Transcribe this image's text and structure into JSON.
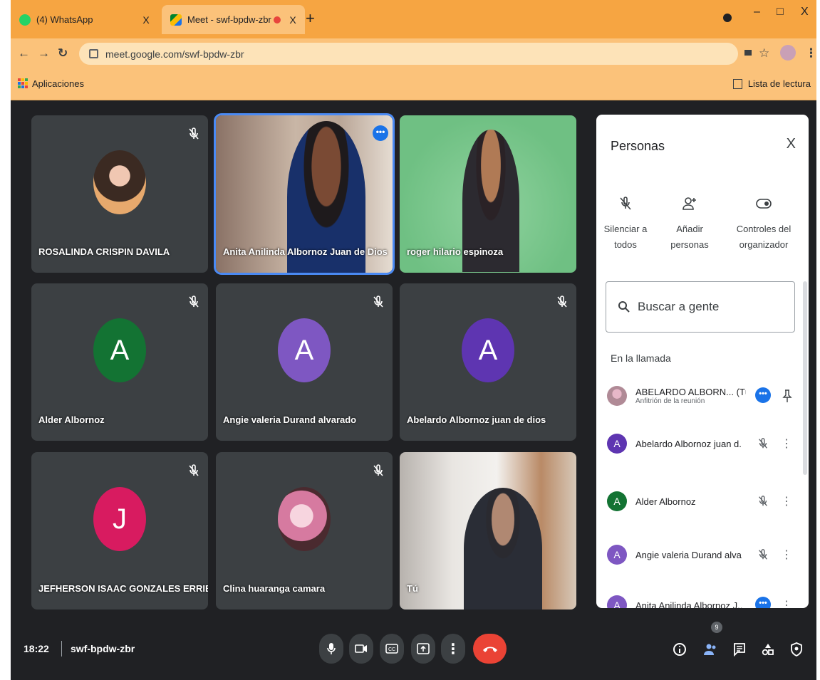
{
  "browser": {
    "tabs": [
      {
        "title": "(4) WhatsApp",
        "close": "X"
      },
      {
        "title": "Meet - swf-bpdw-zbr",
        "close": "X"
      }
    ],
    "new_tab": "+",
    "window_controls": {
      "minimize": "–",
      "maximize": "□",
      "close": "X"
    },
    "url": "meet.google.com/swf-bpdw-zbr",
    "bookmarks": {
      "apps": "Aplicaciones",
      "reading_list": "Lista de lectura"
    }
  },
  "tiles": [
    {
      "name": "ROSALINDA CRISPIN DAVILA"
    },
    {
      "name": "Anita Anilinda Albornoz Juan de Dios"
    },
    {
      "name": "roger hilario espinoza"
    },
    {
      "name": "Alder Albornoz",
      "initial": "A"
    },
    {
      "name": "Angie valeria Durand alvarado",
      "initial": "A"
    },
    {
      "name": "Abelardo Albornoz juan de dios",
      "initial": "A"
    },
    {
      "name": "JEFHERSON ISAAC GONZALES ERRIBA...",
      "initial": "J"
    },
    {
      "name": "Clina huaranga camara"
    },
    {
      "name": "Tú"
    }
  ],
  "panel": {
    "title": "Personas",
    "close": "X",
    "actions": [
      {
        "line1": "Silenciar a",
        "line2": "todos"
      },
      {
        "line1": "Añadir",
        "line2": "personas"
      },
      {
        "line1": "Controles del",
        "line2": "organizador"
      }
    ],
    "search_placeholder": "Buscar a gente",
    "section": "En la llamada",
    "people": [
      {
        "name": "ABELARDO ALBORN...  (Tú)",
        "sub": "Anfitrión de la reunión"
      },
      {
        "name": "Abelardo Albornoz juan d...",
        "initial": "A"
      },
      {
        "name": "Alder Albornoz",
        "initial": "A"
      },
      {
        "name": "Angie valeria Durand alva...",
        "initial": "A"
      },
      {
        "name": "Anita Anilinda Albornoz J...",
        "initial": "A"
      }
    ]
  },
  "bottom": {
    "time": "18:22",
    "meeting_code": "swf-bpdw-zbr",
    "participants_count": "9"
  },
  "colors": {
    "tab_bar": "#f6a542",
    "meet_bg": "#202124",
    "tile_bg": "#3c4043",
    "accent_blue": "#1a73e8",
    "end_call_red": "#ea4335",
    "green_avatar": "#137333",
    "purple_avatar": "#7e57c2",
    "deep_purple_avatar": "#5e35b1",
    "pink_avatar": "#d81b60"
  }
}
